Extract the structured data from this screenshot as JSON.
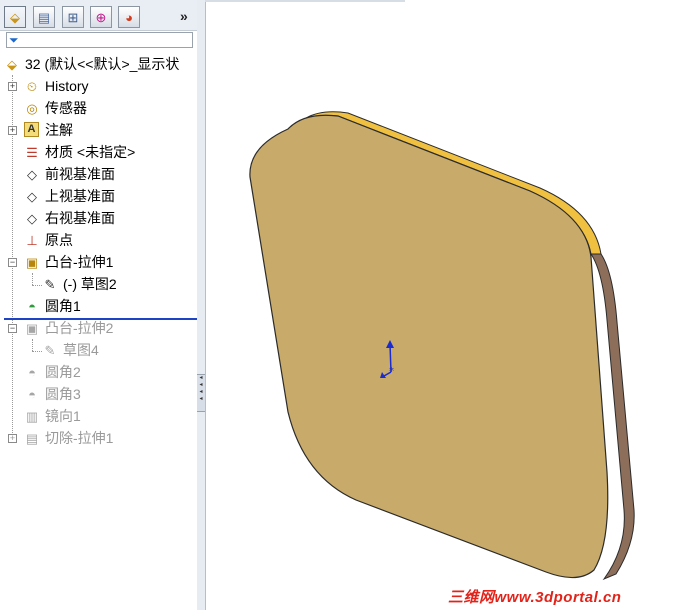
{
  "tabs": [
    {
      "icon": "feature-manager-icon"
    },
    {
      "icon": "property-manager-icon"
    },
    {
      "icon": "configuration-manager-icon"
    },
    {
      "icon": "dimxpert-icon"
    },
    {
      "icon": "display-manager-icon"
    }
  ],
  "tabs_more_label": "»",
  "tree": {
    "root": "32  (默认<<默认>_显示状",
    "items": [
      {
        "label": "History",
        "icon": "history-icon",
        "expandable": true
      },
      {
        "label": "传感器",
        "icon": "sensor-icon",
        "expandable": false
      },
      {
        "label": "注解",
        "icon": "annotations-icon",
        "expandable": true
      },
      {
        "label": "材质 <未指定>",
        "icon": "material-icon",
        "expandable": false
      },
      {
        "label": "前视基准面",
        "icon": "plane-icon",
        "expandable": false
      },
      {
        "label": "上视基准面",
        "icon": "plane-icon",
        "expandable": false
      },
      {
        "label": "右视基准面",
        "icon": "plane-icon",
        "expandable": false
      },
      {
        "label": "原点",
        "icon": "origin-icon",
        "expandable": false
      },
      {
        "label": "凸台-拉伸1",
        "icon": "extrude-icon",
        "expandable": true,
        "expanded": true
      },
      {
        "label": "(-) 草图2",
        "icon": "sketch-icon",
        "child": true
      },
      {
        "label": "圆角1",
        "icon": "fillet-icon",
        "expandable": false
      }
    ],
    "suppressed": [
      {
        "label": "凸台-拉伸2",
        "icon": "extrude-icon",
        "expandable": true,
        "expanded": true
      },
      {
        "label": "草图4",
        "icon": "sketch-icon",
        "child": true
      },
      {
        "label": "圆角2",
        "icon": "fillet-icon"
      },
      {
        "label": "圆角3",
        "icon": "fillet-icon"
      },
      {
        "label": "镜向1",
        "icon": "mirror-icon"
      },
      {
        "label": "切除-拉伸1",
        "icon": "cut-extrude-icon",
        "expandable": true
      }
    ]
  },
  "colors": {
    "part_face": "#c8aa6a",
    "part_edge_top": "#f0c040",
    "part_edge_side": "#8c6e5a",
    "rollback_bar": "#1f43c5",
    "watermark": "#e2231a"
  },
  "watermark": "三维网www.3dportal.cn"
}
